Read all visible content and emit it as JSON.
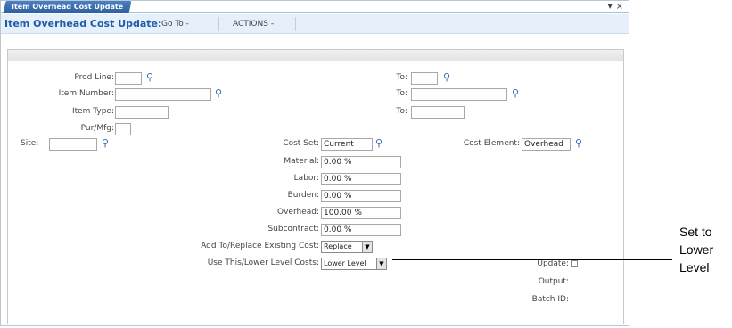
{
  "tab": {
    "label": "Item Overhead Cost Update"
  },
  "window_controls": {
    "dropdown": "▾",
    "close": "×"
  },
  "toolbar": {
    "title": "Item Overhead Cost Update:",
    "goto": "Go To -",
    "actions": "ACTIONS -"
  },
  "form": {
    "prod_line": {
      "label": "Prod Line:",
      "value": "",
      "to_label": "To:",
      "to_value": ""
    },
    "item_number": {
      "label": "Item Number:",
      "value": "",
      "to_label": "To:",
      "to_value": ""
    },
    "item_type": {
      "label": "Item Type:",
      "value": "",
      "to_label": "To:",
      "to_value": ""
    },
    "pur_mfg": {
      "label": "Pur/Mfg:",
      "value": ""
    },
    "site": {
      "label": "Site:",
      "value": ""
    },
    "cost_set": {
      "label": "Cost Set:",
      "value": "Current"
    },
    "cost_element": {
      "label": "Cost Element:",
      "value": "Overhead"
    },
    "material": {
      "label": "Material:",
      "value": "0.00 %"
    },
    "labor": {
      "label": "Labor:",
      "value": "0.00 %"
    },
    "burden": {
      "label": "Burden:",
      "value": "0.00 %"
    },
    "overhead": {
      "label": "Overhead:",
      "value": "100.00 %"
    },
    "subcontract": {
      "label": "Subcontract:",
      "value": "0.00 %"
    },
    "add_replace": {
      "label": "Add To/Replace Existing Cost:",
      "value": "Replace"
    },
    "use_lower": {
      "label": "Use This/Lower Level Costs:",
      "value": "Lower Level"
    },
    "update": {
      "label": "Update:",
      "checked": false
    },
    "output": {
      "label": "Output:"
    },
    "batch_id": {
      "label": "Batch ID:"
    }
  },
  "callout": {
    "line1": "Set to",
    "line2": "Lower",
    "line3": "Level"
  },
  "icons": {
    "lookup": "magnifier-icon",
    "dropdown": "down-arrow-icon"
  }
}
